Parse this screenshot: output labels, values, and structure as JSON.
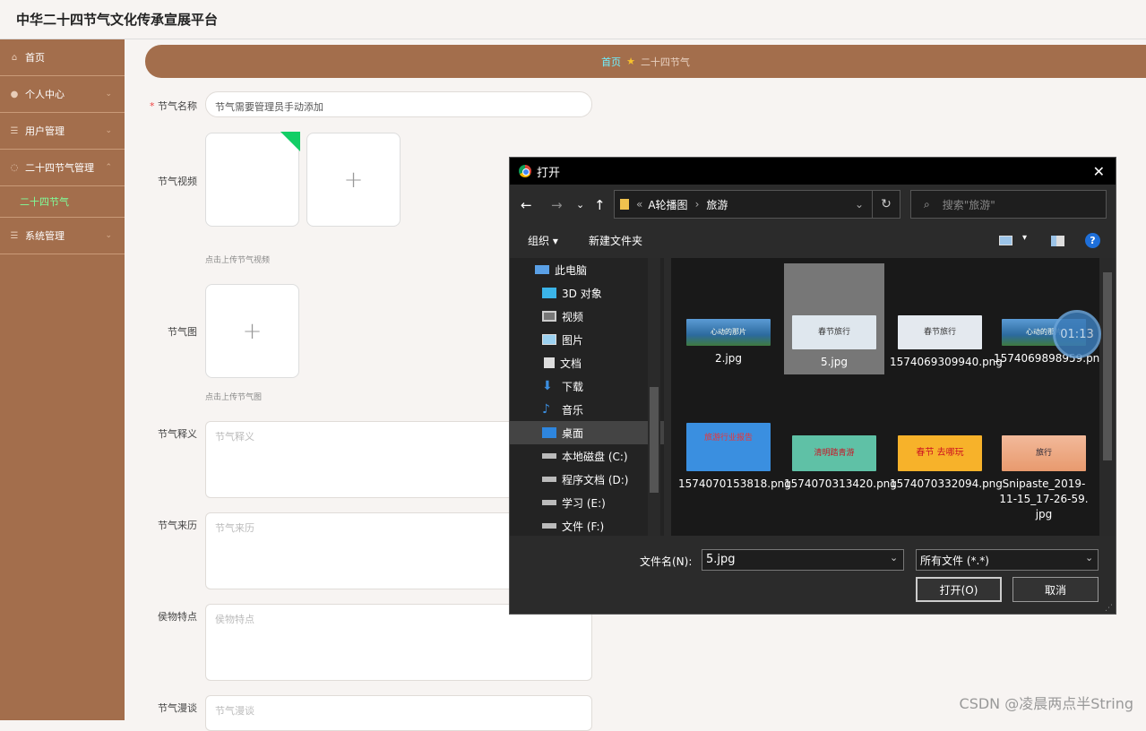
{
  "app": {
    "title": "中华二十四节气文化传承宣展平台"
  },
  "sidebar": {
    "items": [
      {
        "label": "首页",
        "icon": "home-icon"
      },
      {
        "label": "个人中心",
        "icon": "user-icon"
      },
      {
        "label": "用户管理",
        "icon": "list-icon"
      },
      {
        "label": "二十四节气管理",
        "icon": "circle-icon"
      },
      {
        "label": "二十四节气",
        "icon": ""
      },
      {
        "label": "系统管理",
        "icon": "menu-icon"
      }
    ]
  },
  "breadcrumb": {
    "home": "首页",
    "current": "二十四节气"
  },
  "form": {
    "name_label": "节气名称",
    "name_value": "节气需要管理员手动添加",
    "video_label": "节气视频",
    "video_hint": "点击上传节气视频",
    "image_label": "节气图",
    "image_hint": "点击上传节气图",
    "meaning_label": "节气释义",
    "meaning_placeholder": "节气释义",
    "origin_label": "节气来历",
    "origin_placeholder": "节气来历",
    "phenology_label": "侯物特点",
    "phenology_placeholder": "侯物特点",
    "custom_label": "节气漫谈",
    "custom_placeholder": "节气漫谈",
    "plus": "+"
  },
  "dialog": {
    "title": "打开",
    "path_prefix": "«",
    "path_parent": "A轮播图",
    "path_current": "旅游",
    "search_placeholder": "搜索\"旅游\"",
    "organize": "组织 ▾",
    "new_folder": "新建文件夹",
    "tree": [
      {
        "label": "此电脑",
        "icon": "computer-icon"
      },
      {
        "label": "3D 对象",
        "icon": "cube-icon"
      },
      {
        "label": "视频",
        "icon": "video-icon"
      },
      {
        "label": "图片",
        "icon": "picture-icon"
      },
      {
        "label": "文档",
        "icon": "document-icon"
      },
      {
        "label": "下载",
        "icon": "download-icon"
      },
      {
        "label": "音乐",
        "icon": "music-icon"
      },
      {
        "label": "桌面",
        "icon": "desktop-icon"
      },
      {
        "label": "本地磁盘 (C:)",
        "icon": "drive-icon"
      },
      {
        "label": "程序文档 (D:)",
        "icon": "drive-icon"
      },
      {
        "label": "学习 (E:)",
        "icon": "drive-icon"
      },
      {
        "label": "文件 (F:)",
        "icon": "drive-icon"
      }
    ],
    "files": [
      {
        "name": "2.jpg",
        "color": "#2c6a9e"
      },
      {
        "name": "5.jpg",
        "color": "#dfe7ee"
      },
      {
        "name": "1574069309940.png",
        "color": "#e4e9ef"
      },
      {
        "name": "1574069898959.png",
        "color": "#2c6a9e"
      },
      {
        "name": "1574070153818.png",
        "color": "#3a8fe0"
      },
      {
        "name": "1574070313420.png",
        "color": "#5fc1a6"
      },
      {
        "name": "1574070332094.png",
        "color": "#f7b22a"
      },
      {
        "name": "Snipaste_2019-11-15_17-26-59.jpg",
        "color": "#e89a6e"
      }
    ],
    "thumb_texts": {
      "f2": "心动的那片",
      "f5": "春节旅行",
      "f3": "春节旅行",
      "f4": "心动的那片",
      "f6": "旅游行业报告",
      "f7": "清明踏青游",
      "f8": "春节 去哪玩",
      "f9": "旅行"
    },
    "filename_label": "文件名(N):",
    "filename_value": "5.jpg",
    "filter_value": "所有文件 (*.*)",
    "open_button": "打开(O)",
    "cancel_button": "取消"
  },
  "timer": "01:13",
  "watermark": "CSDN @凌晨两点半String"
}
